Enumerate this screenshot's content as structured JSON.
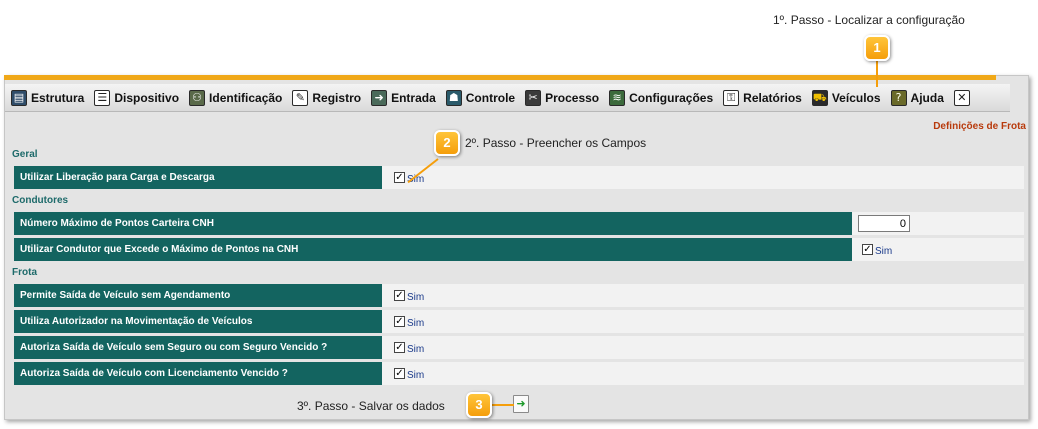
{
  "steps": [
    {
      "number": "1",
      "text": "1º. Passo - Localizar a configuração"
    },
    {
      "number": "2",
      "text": "2º. Passo - Preencher os Campos"
    },
    {
      "number": "3",
      "text": "3º. Passo - Salvar os dados"
    }
  ],
  "menu": {
    "items": [
      {
        "label": "Estrutura",
        "icon": "structure-icon"
      },
      {
        "label": "Dispositivo",
        "icon": "device-icon"
      },
      {
        "label": "Identificação",
        "icon": "identification-icon"
      },
      {
        "label": "Registro",
        "icon": "register-icon"
      },
      {
        "label": "Entrada",
        "icon": "entry-icon"
      },
      {
        "label": "Controle",
        "icon": "control-icon"
      },
      {
        "label": "Processo",
        "icon": "process-icon"
      },
      {
        "label": "Configurações",
        "icon": "settings-icon"
      },
      {
        "label": "Relatórios",
        "icon": "reports-icon"
      },
      {
        "label": "Veículos",
        "icon": "vehicle-icon"
      },
      {
        "label": "Ajuda",
        "icon": "help-icon"
      }
    ]
  },
  "page": {
    "breadcrumb": "Definições de Frota"
  },
  "sections": {
    "geral": "Geral",
    "condutores": "Condutores",
    "frota": "Frota"
  },
  "fields": {
    "liberacao_carga": {
      "label": "Utilizar Liberação para Carga e Descarga",
      "checked": true,
      "option": "Sim"
    },
    "max_pontos": {
      "label": "Número Máximo de Pontos Carteira CNH",
      "value": "0"
    },
    "condutor_excede": {
      "label": "Utilizar Condutor que Excede o Máximo de Pontos na CNH",
      "checked": true,
      "option": "Sim"
    },
    "saida_sem_agendamento": {
      "label": "Permite Saída de Veículo sem Agendamento",
      "checked": true,
      "option": "Sim"
    },
    "autorizador_movimentacao": {
      "label": "Utiliza Autorizador na Movimentação de Veículos",
      "checked": true,
      "option": "Sim"
    },
    "saida_sem_seguro": {
      "label": "Autoriza Saída de Veículo sem Seguro ou com Seguro Vencido ?",
      "checked": true,
      "option": "Sim"
    },
    "saida_licenciamento": {
      "label": "Autoriza Saída de Veículo com Licenciamento Vencido ?",
      "checked": true,
      "option": "Sim"
    }
  },
  "colors": {
    "accent": "#f0a818",
    "label_bg": "#136460",
    "section_text": "#1d6a6a",
    "breadcrumb_text": "#b83a0c"
  }
}
